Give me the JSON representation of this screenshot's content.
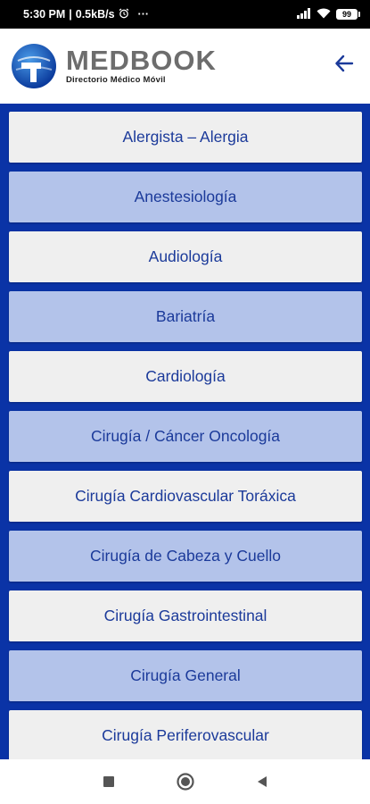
{
  "status_bar": {
    "time": "5:30 PM",
    "speed": "0.5kB/s",
    "alarm_icon": "alarm-icon",
    "more": "···",
    "signal_icon": "signal-icon",
    "wifi_icon": "wifi-icon",
    "battery": "99"
  },
  "header": {
    "brand_title": "MEDBOOK",
    "brand_subtitle": "Directorio Médico Móvil",
    "back_icon": "arrow-left-icon"
  },
  "specialties": [
    "Alergista – Alergia",
    "Anestesiología",
    "Audiología",
    "Bariatría",
    "Cardiología",
    "Cirugía / Cáncer Oncología",
    "Cirugía Cardiovascular Toráxica",
    "Cirugía de Cabeza y Cuello",
    "Cirugía Gastrointestinal",
    "Cirugía General",
    "Cirugía Periferovascular"
  ],
  "nav": {
    "recents_icon": "square-icon",
    "home_icon": "circle-icon",
    "back_icon": "triangle-back-icon"
  },
  "colors": {
    "list_background": "#0a33a6",
    "item_light": "#efefef",
    "item_blue": "#b3c3ea",
    "item_text": "#1b3a9a",
    "brand_gray": "#6d6d6d"
  }
}
